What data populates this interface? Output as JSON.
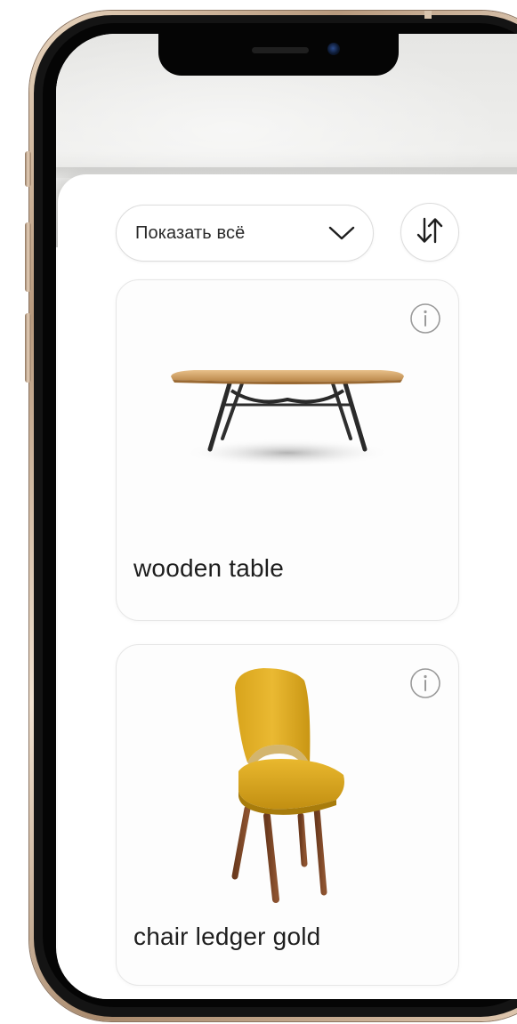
{
  "filter": {
    "selected_label": "Показать всё",
    "chevron_icon": "chevron-down-icon"
  },
  "sort": {
    "icon": "sort-arrows-icon"
  },
  "products": [
    {
      "name": "wooden table",
      "image_icon": "wooden-table-image",
      "info_icon": "info-icon"
    },
    {
      "name": "chair ledger gold",
      "image_icon": "yellow-chair-image",
      "info_icon": "info-icon"
    }
  ],
  "colors": {
    "frame_gold": "#c9ad92",
    "chair_yellow": "#e2b22a",
    "table_wood": "#d9a86a"
  }
}
